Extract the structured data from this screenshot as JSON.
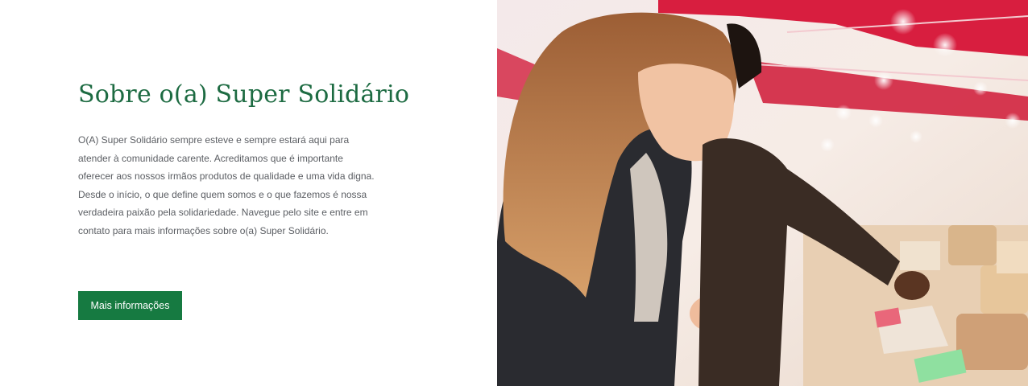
{
  "about": {
    "title": "Sobre o(a) Super Solidário",
    "body": "O(A) Super Solidário sempre esteve e sempre estará aqui para atender à comunidade carente. Acreditamos que é importante oferecer aos nossos irmãos produtos de qualidade e uma vida digna. Desde o início, o que define quem somos e o que fazemos é nossa verdadeira paixão pela solidariedade. Navegue pelo site e entre em contato para mais informações sobre o(a) Super Solidário.",
    "button_label": "Mais informações"
  },
  "photo": {
    "subject": "couple-at-market-stall-photo"
  },
  "colors": {
    "title": "#1d6b42",
    "button": "#167a41",
    "body_text": "#5b5e63"
  }
}
